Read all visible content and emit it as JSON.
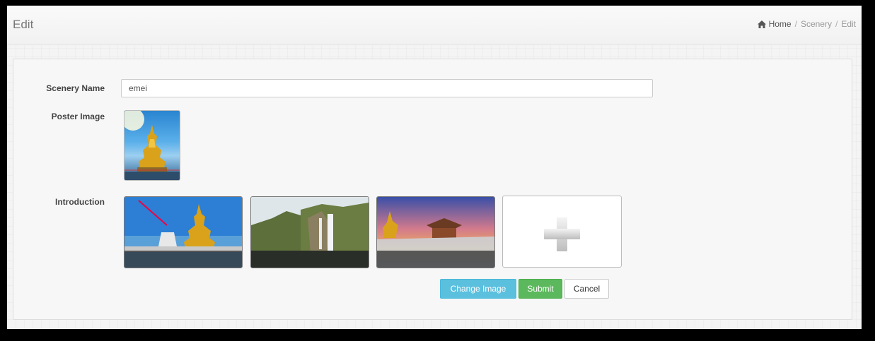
{
  "header": {
    "title": "Edit",
    "breadcrumb": {
      "home": "Home",
      "section": "Scenery",
      "current": "Edit",
      "separator": "/"
    }
  },
  "form": {
    "scenery_name": {
      "label": "Scenery Name",
      "value": "emei"
    },
    "poster": {
      "label": "Poster Image"
    },
    "introduction": {
      "label": "Introduction",
      "images": [
        "golden-buddha-statue",
        "waterfall-cliffs",
        "temple-at-sunset"
      ]
    }
  },
  "actions": {
    "change_image": "Change Image",
    "submit": "Submit",
    "cancel": "Cancel"
  },
  "icons": {
    "home": "home-icon",
    "add": "plus-icon"
  },
  "colors": {
    "info": "#5bc0de",
    "success": "#5cb85c"
  }
}
